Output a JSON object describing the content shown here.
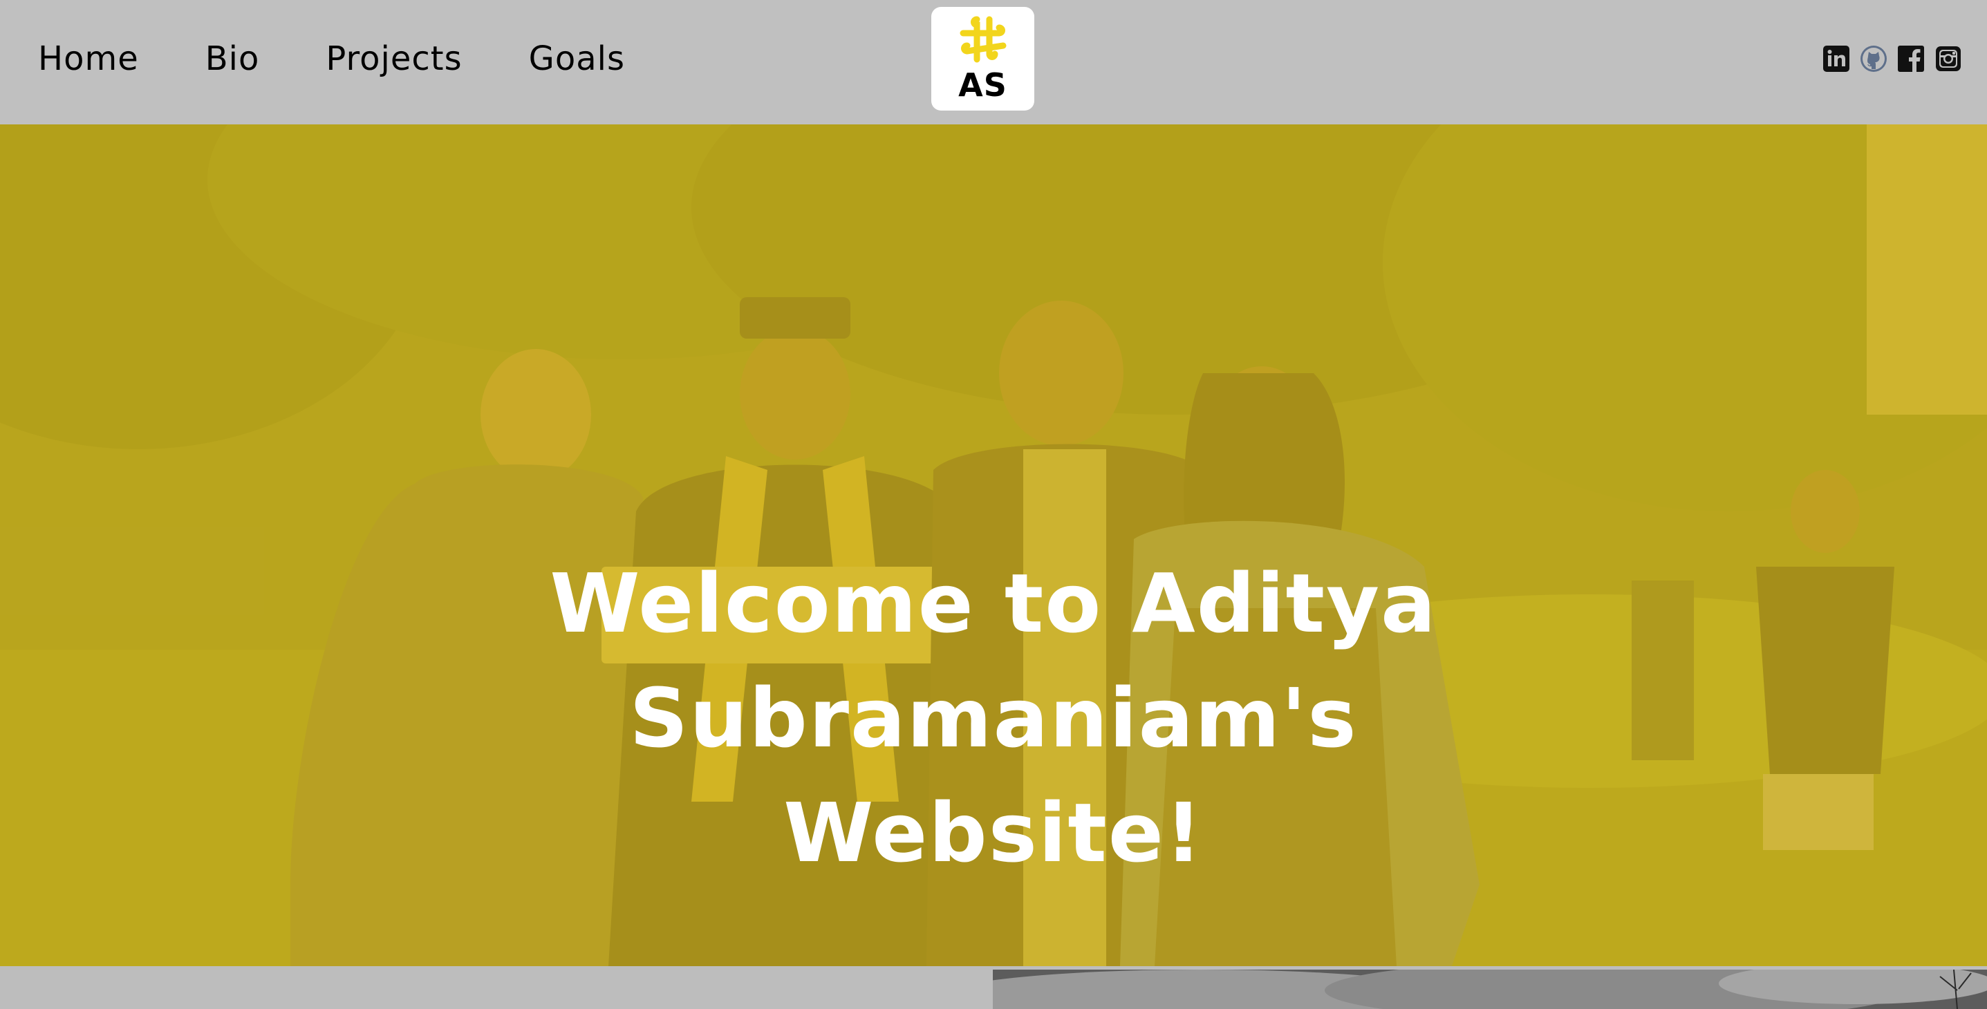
{
  "nav": {
    "links": [
      {
        "label": "Home"
      },
      {
        "label": "Bio"
      },
      {
        "label": "Projects"
      },
      {
        "label": "Goals"
      }
    ]
  },
  "logo": {
    "text": "AS",
    "accent_color": "#f2d51c"
  },
  "social": [
    {
      "icon": "linkedin-icon"
    },
    {
      "icon": "github-icon"
    },
    {
      "icon": "facebook-icon"
    },
    {
      "icon": "instagram-icon"
    }
  ],
  "hero": {
    "title": "Welcome to Aditya Subramaniam's Website!",
    "overlay_color": "#d6b618",
    "image_description": "graduation family photo"
  },
  "colors": {
    "navbar_bg": "#c0c0c0",
    "title_text": "#ffffff"
  }
}
